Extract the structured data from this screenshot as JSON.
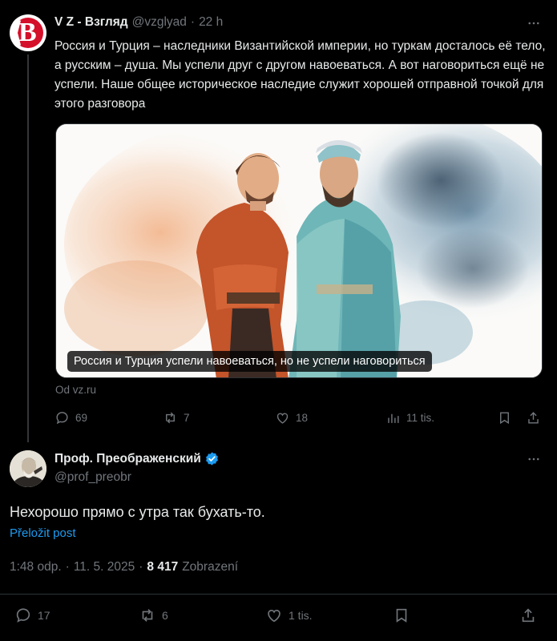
{
  "parent_tweet": {
    "author_name": "V Z - Взгляд",
    "handle": "@vzglyad",
    "separator": "·",
    "time": "22 h",
    "text": "Россия и Турция – наследники Византийской империи, но туркам досталось её тело, а русским – душа. Мы успели друг с другом навоеваться. А вот наговориться ещё не успели. Наше общее историческое наследие служит хорошей отправной точкой для этого разговора",
    "media_caption": "Россия и Турция успели навоеваться, но не успели наговориться",
    "source": "Od vz.ru",
    "actions": {
      "replies": "69",
      "reposts": "7",
      "likes": "18",
      "views": "11 tis."
    }
  },
  "main_tweet": {
    "author_name": "Проф. Преображенский",
    "handle": "@prof_preobr",
    "text": "Нехорошо прямо с утра так бухать-то.",
    "translate_label": "Přeložit post",
    "time": "1:48 odp.",
    "date": "11. 5. 2025",
    "separator": "·",
    "views_count": "8 417",
    "views_label": "Zobrazení",
    "actions": {
      "replies": "17",
      "reposts": "6",
      "likes": "1 tis."
    }
  },
  "colors": {
    "background": "#000000",
    "text": "#e7e9ea",
    "muted": "#71767b",
    "link": "#1d9bf0",
    "divider": "#2f3336",
    "avatar_brand": "#d5102a"
  },
  "icons": [
    "more-icon",
    "reply-icon",
    "repost-icon",
    "like-icon",
    "views-icon",
    "bookmark-icon",
    "share-icon",
    "verified-badge-icon"
  ]
}
